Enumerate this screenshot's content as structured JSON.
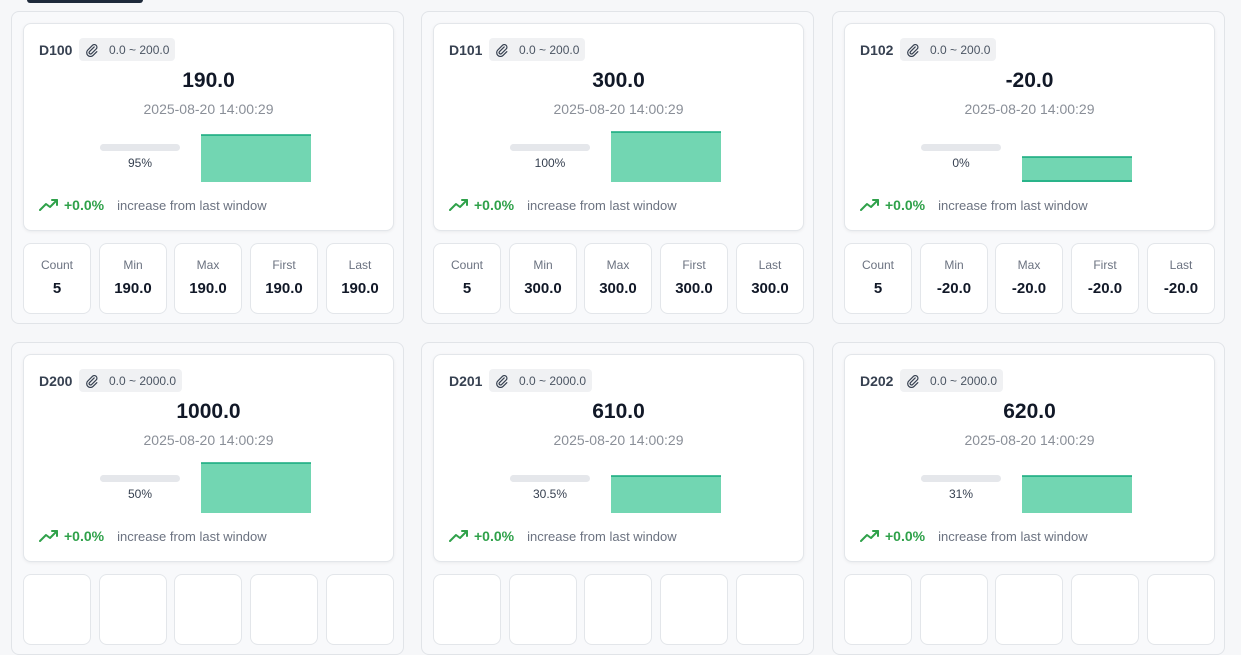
{
  "colors": {
    "accent_green": "#2fa14a",
    "spark_fill": "#72d6b2",
    "spark_line": "#13a97c",
    "progress_track": "#e5e7eb"
  },
  "icons": {
    "range": "paperclip-icon",
    "trend": "trending-up-icon"
  },
  "panels": [
    {
      "tag": "D100",
      "range": "0.0 ~ 200.0",
      "value": "190.0",
      "timestamp": "2025-08-20 14:00:29",
      "progress": 0.95,
      "progress_label": "95%",
      "spark_level": 0.95,
      "delta": "+0.0%",
      "delta_note": "increase from last window",
      "stats": [
        {
          "label": "Count",
          "value": "5"
        },
        {
          "label": "Min",
          "value": "190.0"
        },
        {
          "label": "Max",
          "value": "190.0"
        },
        {
          "label": "First",
          "value": "190.0"
        },
        {
          "label": "Last",
          "value": "190.0"
        }
      ]
    },
    {
      "tag": "D101",
      "range": "0.0 ~ 200.0",
      "value": "300.0",
      "timestamp": "2025-08-20 14:00:29",
      "progress": 1.0,
      "progress_label": "100%",
      "spark_level": 1.0,
      "delta": "+0.0%",
      "delta_note": "increase from last window",
      "stats": [
        {
          "label": "Count",
          "value": "5"
        },
        {
          "label": "Min",
          "value": "300.0"
        },
        {
          "label": "Max",
          "value": "300.0"
        },
        {
          "label": "First",
          "value": "300.0"
        },
        {
          "label": "Last",
          "value": "300.0"
        }
      ]
    },
    {
      "tag": "D102",
      "range": "0.0 ~ 200.0",
      "value": "-20.0",
      "timestamp": "2025-08-20 14:00:29",
      "progress": 0.0,
      "progress_label": "0%",
      "spark_level": 0.5,
      "delta": "+0.0%",
      "delta_note": "increase from last window",
      "stats": [
        {
          "label": "Count",
          "value": "5"
        },
        {
          "label": "Min",
          "value": "-20.0"
        },
        {
          "label": "Max",
          "value": "-20.0"
        },
        {
          "label": "First",
          "value": "-20.0"
        },
        {
          "label": "Last",
          "value": "-20.0"
        }
      ]
    },
    {
      "tag": "D200",
      "range": "0.0 ~ 2000.0",
      "value": "1000.0",
      "timestamp": "2025-08-20 14:00:29",
      "progress": 0.5,
      "progress_label": "50%",
      "spark_level": 1.0,
      "delta": "+0.0%",
      "delta_note": "increase from last window",
      "stats": []
    },
    {
      "tag": "D201",
      "range": "0.0 ~ 2000.0",
      "value": "610.0",
      "timestamp": "2025-08-20 14:00:29",
      "progress": 0.305,
      "progress_label": "30.5%",
      "spark_level": 0.75,
      "delta": "+0.0%",
      "delta_note": "increase from last window",
      "stats": []
    },
    {
      "tag": "D202",
      "range": "0.0 ~ 2000.0",
      "value": "620.0",
      "timestamp": "2025-08-20 14:00:29",
      "progress": 0.31,
      "progress_label": "31%",
      "spark_level": 0.75,
      "delta": "+0.0%",
      "delta_note": "increase from last window",
      "stats": []
    }
  ]
}
